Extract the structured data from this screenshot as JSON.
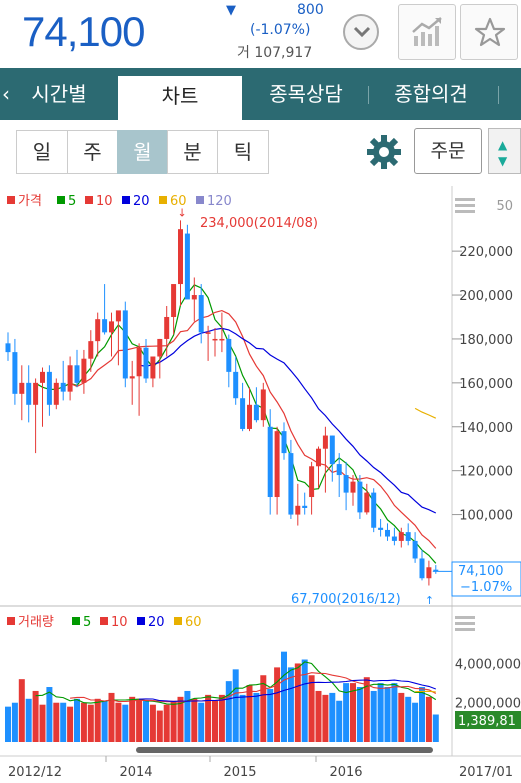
{
  "header": {
    "price": "74,100",
    "change_arrow": "▼",
    "change": "800",
    "change_pct": "(-1.07%)",
    "volume": "거 107,917",
    "icons": [
      "chevron-down-icon",
      "trend-chart-icon",
      "star-icon"
    ]
  },
  "tabs": [
    {
      "label": "시간별"
    },
    {
      "label": "차트"
    },
    {
      "label": "종목상담"
    },
    {
      "label": "종합의견"
    }
  ],
  "periods": [
    {
      "label": "일"
    },
    {
      "label": "주"
    },
    {
      "label": "월"
    },
    {
      "label": "분"
    },
    {
      "label": "틱"
    }
  ],
  "active_period": "월",
  "order_label": "주문",
  "colors": {
    "up": "#e53935",
    "down": "#1e90ff",
    "ma5": "#009900",
    "ma10": "#e53935",
    "ma20": "#0000dd",
    "ma60": "#e8b000",
    "ma120": "#8888cc",
    "teal": "#2c6a72"
  },
  "chart_data": [
    {
      "type": "candlestick",
      "legend": [
        {
          "label": "가격"
        },
        {
          "label": "5"
        },
        {
          "label": "10"
        },
        {
          "label": "20"
        },
        {
          "label": "60"
        },
        {
          "label": "120"
        }
      ],
      "scale_top_label": "50",
      "y_ticks": [
        "220,000",
        "200,000",
        "180,000",
        "160,000",
        "140,000",
        "120,000",
        "100,000"
      ],
      "y_tick_values": [
        220000,
        200000,
        180000,
        160000,
        140000,
        120000,
        100000
      ],
      "ylim": [
        62000,
        236000
      ],
      "max_label": "234,000(2014/08)",
      "min_label": "67,700(2016/12)",
      "current_price": "74,100",
      "current_change": "−1.07%",
      "candles": [
        [
          178000,
          183000,
          170000,
          174000
        ],
        [
          174000,
          180000,
          150000,
          155000
        ],
        [
          155000,
          168000,
          143000,
          160000
        ],
        [
          160000,
          168000,
          142000,
          150000
        ],
        [
          150000,
          162000,
          128000,
          160000
        ],
        [
          160000,
          167000,
          140000,
          165000
        ],
        [
          165000,
          168000,
          145000,
          150000
        ],
        [
          150000,
          162000,
          148000,
          160000
        ],
        [
          160000,
          170000,
          152000,
          156000
        ],
        [
          156000,
          172000,
          152000,
          168000
        ],
        [
          168000,
          175000,
          158000,
          160000
        ],
        [
          160000,
          175000,
          155000,
          171000
        ],
        [
          171000,
          184000,
          165000,
          179000
        ],
        [
          179000,
          192000,
          172000,
          189000
        ],
        [
          189000,
          205000,
          182000,
          183000
        ],
        [
          183000,
          192000,
          172000,
          188000
        ],
        [
          188000,
          192000,
          168000,
          193000
        ],
        [
          193000,
          197000,
          158000,
          162000
        ],
        [
          162000,
          170000,
          150000,
          163000
        ],
        [
          163000,
          178000,
          145000,
          176000
        ],
        [
          176000,
          180000,
          160000,
          162000
        ],
        [
          162000,
          170000,
          158000,
          172000
        ],
        [
          172000,
          180000,
          162000,
          180000
        ],
        [
          180000,
          195000,
          172000,
          190000
        ],
        [
          190000,
          204000,
          182000,
          205000
        ],
        [
          205000,
          234000,
          195000,
          230000
        ],
        [
          228000,
          232000,
          208000,
          198000
        ],
        [
          198000,
          208000,
          188000,
          200000
        ],
        [
          200000,
          205000,
          178000,
          183000
        ],
        [
          183000,
          186000,
          170000,
          183000
        ],
        [
          180000,
          185000,
          172000,
          180000
        ],
        [
          180000,
          192000,
          174000,
          180000
        ],
        [
          180000,
          182000,
          158000,
          165000
        ],
        [
          165000,
          172000,
          150000,
          153000
        ],
        [
          153000,
          160000,
          138000,
          139000
        ],
        [
          139000,
          158000,
          138000,
          150000
        ],
        [
          150000,
          158000,
          142000,
          143000
        ],
        [
          143000,
          160000,
          140000,
          157000
        ],
        [
          140000,
          148000,
          100000,
          108000
        ],
        [
          108000,
          140000,
          100000,
          138000
        ],
        [
          138000,
          142000,
          125000,
          128000
        ],
        [
          128000,
          134000,
          98000,
          100000
        ],
        [
          100000,
          114000,
          95000,
          104000
        ],
        [
          104000,
          110000,
          100000,
          103000
        ],
        [
          108000,
          124000,
          100000,
          122000
        ],
        [
          122000,
          131000,
          112000,
          130000
        ],
        [
          130000,
          140000,
          110000,
          136000
        ],
        [
          136000,
          136000,
          115000,
          123000
        ],
        [
          123000,
          128000,
          108000,
          118000
        ],
        [
          118000,
          124000,
          102000,
          110000
        ],
        [
          110000,
          118000,
          104000,
          115000
        ],
        [
          115000,
          118000,
          98000,
          101000
        ],
        [
          101000,
          114000,
          100000,
          110000
        ],
        [
          110000,
          112000,
          92000,
          94000
        ],
        [
          94000,
          98000,
          90000,
          93000
        ],
        [
          93000,
          96000,
          88000,
          90000
        ],
        [
          90000,
          94000,
          86000,
          88000
        ],
        [
          88000,
          94000,
          85000,
          92000
        ],
        [
          92000,
          96000,
          86000,
          88000
        ],
        [
          88000,
          92000,
          78000,
          80000
        ],
        [
          80000,
          84000,
          70000,
          71000
        ],
        [
          71000,
          79000,
          67700,
          76000
        ],
        [
          74900,
          77000,
          73000,
          74100
        ]
      ]
    },
    {
      "type": "bar",
      "legend": [
        {
          "label": "거래량"
        },
        {
          "label": "5"
        },
        {
          "label": "10"
        },
        {
          "label": "20"
        },
        {
          "label": "60"
        }
      ],
      "y_ticks": [
        "4,000,000",
        "2,000,000"
      ],
      "y_tick_values": [
        4000000,
        2000000
      ],
      "ylim": [
        0,
        5500000
      ],
      "current_volume": "1,389,81",
      "x_ticks": [
        "2012/12",
        "2014",
        "2015",
        "2016",
        "2017/01"
      ],
      "volumes": [
        1800000,
        2000000,
        3200000,
        2200000,
        2600000,
        1900000,
        2800000,
        2000000,
        2000000,
        1800000,
        2200000,
        2000000,
        1900000,
        2200000,
        2100000,
        2500000,
        2000000,
        1900000,
        2300000,
        2200000,
        2100000,
        1900000,
        1600000,
        1900000,
        2100000,
        2300000,
        2600000,
        2200000,
        2000000,
        2400000,
        2100000,
        2400000,
        3100000,
        3700000,
        2400000,
        2900000,
        2500000,
        3400000,
        2700000,
        3800000,
        4600000,
        3800000,
        4000000,
        4200000,
        3400000,
        2600000,
        2400000,
        2500000,
        2100000,
        3000000,
        3000000,
        2800000,
        3300000,
        2600000,
        3000000,
        2800000,
        3000000,
        2500000,
        2300000,
        2000000,
        2800000,
        2300000,
        1400000
      ]
    }
  ]
}
